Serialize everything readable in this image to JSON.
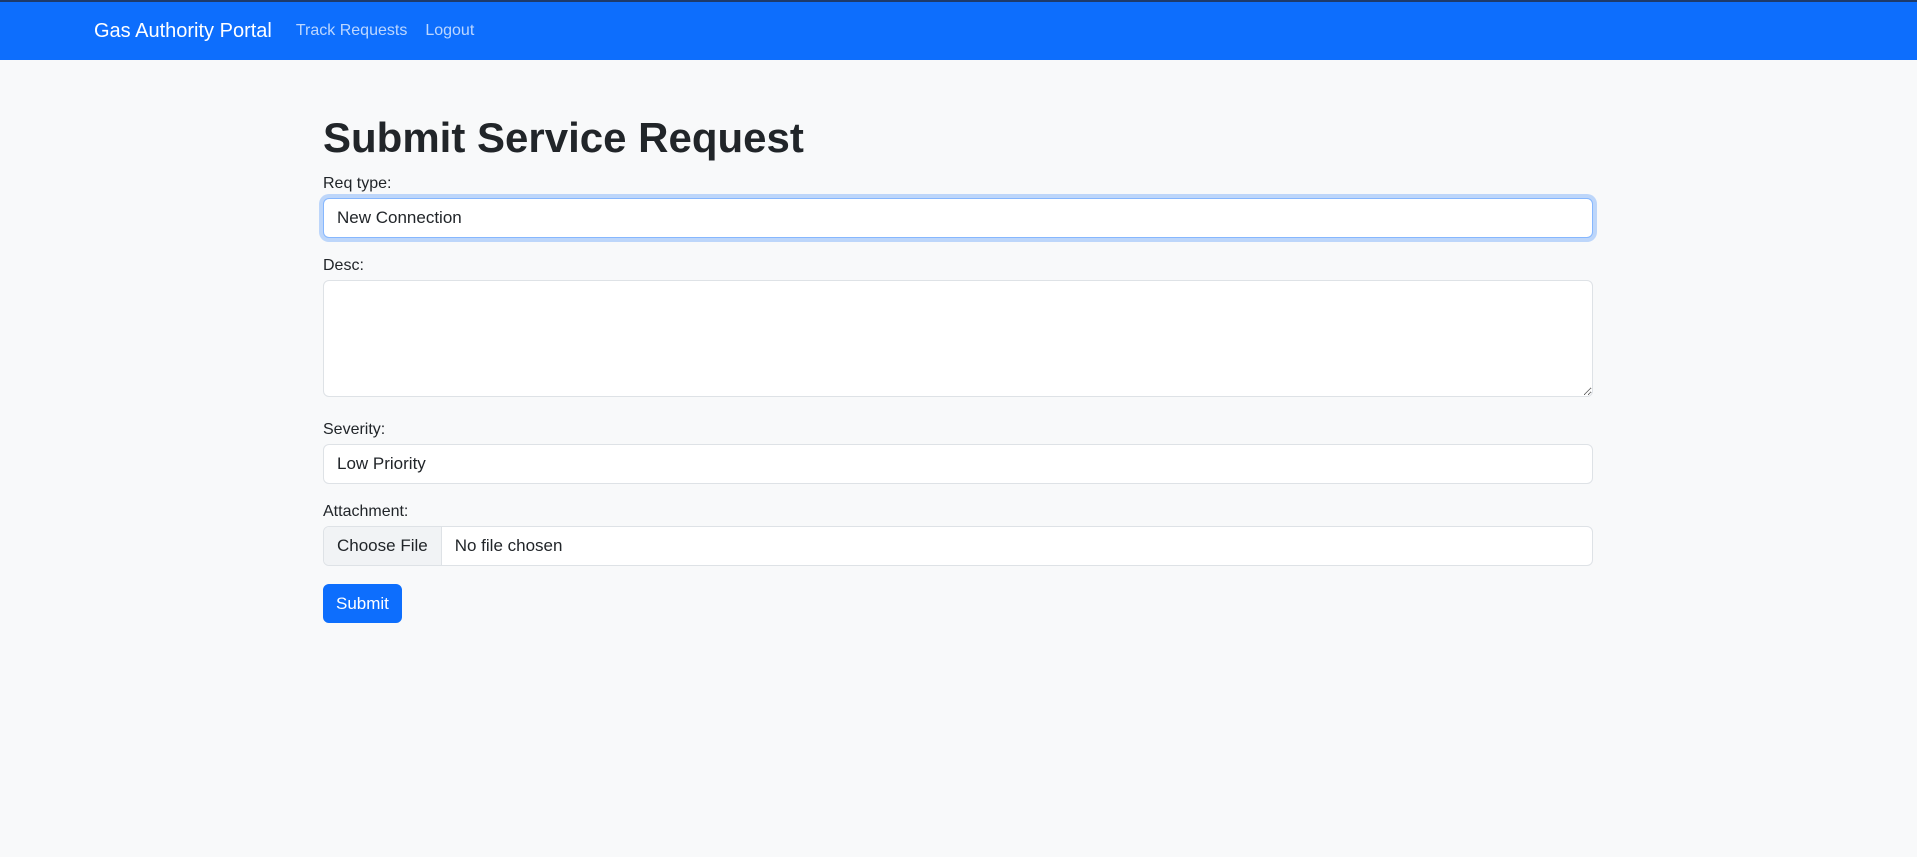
{
  "navbar": {
    "brand": "Gas Authority Portal",
    "links": [
      {
        "label": "Track Requests"
      },
      {
        "label": "Logout"
      }
    ]
  },
  "page": {
    "title": "Submit Service Request"
  },
  "form": {
    "req_type": {
      "label": "Req type:",
      "value": "New Connection"
    },
    "desc": {
      "label": "Desc:",
      "value": ""
    },
    "severity": {
      "label": "Severity:",
      "value": "Low Priority"
    },
    "attachment": {
      "label": "Attachment:",
      "button_label": "Choose File",
      "status": "No file chosen"
    },
    "submit_label": "Submit"
  }
}
